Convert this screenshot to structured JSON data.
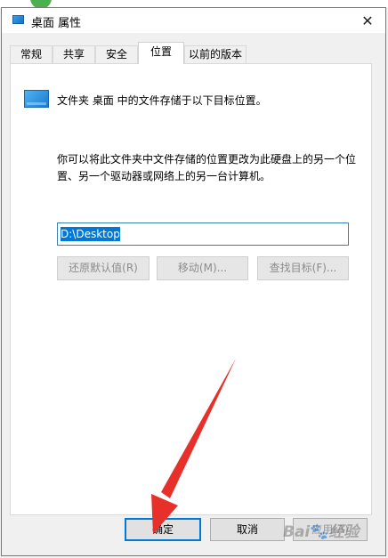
{
  "window": {
    "title": "桌面 属性",
    "close_glyph": "✕"
  },
  "tabs": [
    {
      "label": "常规"
    },
    {
      "label": "共享"
    },
    {
      "label": "安全"
    },
    {
      "label": "位置"
    },
    {
      "label": "以前的版本"
    }
  ],
  "active_tab": "位置",
  "location": {
    "info": "文件夹 桌面 中的文件存储于以下目标位置。",
    "description": "你可以将此文件夹中文件存储的位置更改为此硬盘上的另一个位置、另一个驱动器或网络上的另一台计算机。",
    "path_value": "D:\\Desktop",
    "restore_default_label": "还原默认值(R)",
    "move_label": "移动(M)...",
    "find_target_label": "查找目标(F)..."
  },
  "footer": {
    "ok_label": "确定",
    "cancel_label": "取消",
    "apply_label": "应用(A)"
  },
  "colors": {
    "accent": "#0078d7",
    "arrow": "#e8302a"
  }
}
